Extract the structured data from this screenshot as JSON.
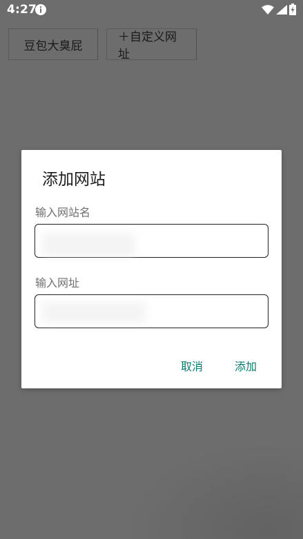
{
  "status_bar": {
    "time": "4:27",
    "icons": [
      "info-icon",
      "wifi-icon",
      "signal-icon",
      "battery-charging-icon"
    ]
  },
  "background": {
    "buttons": [
      {
        "label": "豆包大臭屁"
      },
      {
        "label": "＋自定义网址"
      }
    ]
  },
  "dialog": {
    "title": "添加网站",
    "name_label": "输入网站名",
    "name_value": "",
    "url_label": "输入网址",
    "url_value": "",
    "cancel_label": "取消",
    "confirm_label": "添加"
  },
  "colors": {
    "scrim": "#6d6d6d",
    "accent": "#0b7a6e",
    "dialog_bg": "#ffffff"
  }
}
